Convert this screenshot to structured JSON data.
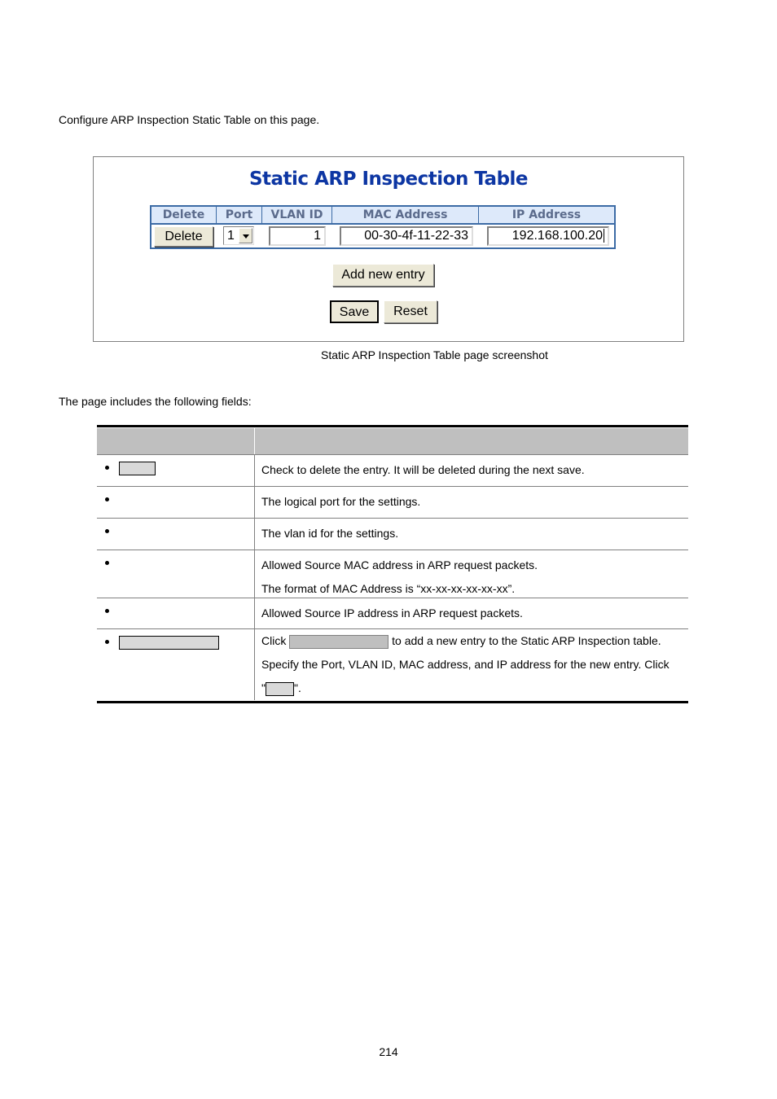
{
  "intro_text": "Configure ARP Inspection Static Table on this page.",
  "screenshot": {
    "title": "Static ARP Inspection Table",
    "columns": [
      "Delete",
      "Port",
      "VLAN ID",
      "MAC Address",
      "IP Address"
    ],
    "row": {
      "delete_label": "Delete",
      "port_value": "1",
      "vlan_id": "1",
      "mac_address": "00-30-4f-11-22-33",
      "ip_address": "192.168.100.20"
    },
    "add_new_entry_label": "Add new entry",
    "save_label": "Save",
    "reset_label": "Reset",
    "title_color": "#0d36a3",
    "header_bg": "#dde9fa",
    "border_color": "#3c6ba5"
  },
  "caption": "Static ARP Inspection Table page screenshot",
  "fields_intro": "The page includes the following fields:",
  "fields_table": {
    "rows": [
      {
        "lines": [
          "Check to delete the entry. It will be deleted during the next save."
        ]
      },
      {
        "lines": [
          "The logical port for the settings."
        ]
      },
      {
        "lines": [
          "The vlan id for the settings."
        ]
      },
      {
        "lines": [
          "Allowed Source MAC address in ARP request packets.",
          "The format of MAC Address is “xx-xx-xx-xx-xx-xx”."
        ]
      },
      {
        "lines": [
          "Allowed Source IP address in ARP request packets."
        ]
      },
      {
        "line1_prefix": "Click",
        "line1_suffix": "to add a new entry to the Static ARP Inspection table.",
        "line2": "Specify the Port, VLAN ID, MAC address, and IP address for the new entry. Click",
        "line3_open": "\"",
        "line3_close": "\"."
      }
    ]
  },
  "page_number": "214"
}
